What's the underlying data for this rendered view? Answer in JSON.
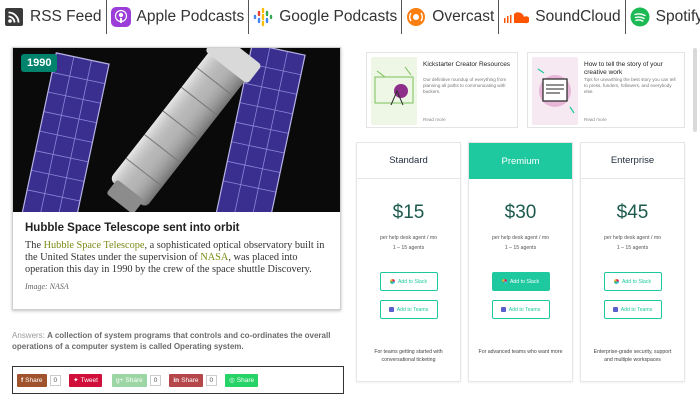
{
  "podcasts": [
    {
      "label": "RSS Feed",
      "icon": "rss-icon"
    },
    {
      "label": "Apple Podcasts",
      "icon": "apple-podcasts-icon"
    },
    {
      "label": "Google Podcasts",
      "icon": "google-podcasts-icon"
    },
    {
      "label": "Overcast",
      "icon": "overcast-icon"
    },
    {
      "label": "SoundCloud",
      "icon": "soundcloud-icon"
    },
    {
      "label": "Spotify",
      "icon": "spotify-icon"
    }
  ],
  "article": {
    "year_badge": "1990",
    "title": "Hubble Space Telescope sent into orbit",
    "text_1": "The ",
    "link_1": "Hubble Space Telescope",
    "text_2": ", a sophisticated optical observatory built in the United States under the supervision of ",
    "link_2": "NASA",
    "text_3": ", was placed into operation this day in 1990 by the crew of the space shuttle Discovery.",
    "credit": "Image: NASA"
  },
  "answers": {
    "label": "Answers: ",
    "text": "A collection of system programs that controls and co-ordinates the overall operations of a computer system is called Operating system."
  },
  "share": [
    {
      "label": "Share",
      "count": "0",
      "color": "#a0522d",
      "icon": "facebook-icon"
    },
    {
      "label": "Tweet",
      "count": "",
      "color": "#d0103a",
      "icon": "twitter-icon"
    },
    {
      "label": "Share",
      "count": "0",
      "color": "#9cd6a4",
      "icon": "google-plus-icon"
    },
    {
      "label": "Share",
      "count": "0",
      "color": "#b5474b",
      "icon": "linkedin-icon"
    },
    {
      "label": "Share",
      "count": "",
      "color": "#25d366",
      "icon": "whatsapp-icon"
    }
  ],
  "resources": [
    {
      "title": "Kickstarter Creator Resources",
      "desc": "Our definitive roundup of everything from planning all paths to communicating with backers.",
      "more": "Read more"
    },
    {
      "title": "How to tell the story of your creative work",
      "desc": "Tips for unearthing the best story you can tell to press, funders, followers, and everybody else.",
      "more": "Read more"
    }
  ],
  "plans": [
    {
      "name": "Standard",
      "price": "$15",
      "per": "per help desk agent / mo",
      "agents": "1 – 15 agents",
      "slack": "Add to Slack",
      "teams": "Add to Teams",
      "foot": "For teams getting started with conversational ticketing"
    },
    {
      "name": "Premium",
      "price": "$30",
      "per": "per help desk agent / mo",
      "agents": "1 – 15 agents",
      "slack": "Add to Slack",
      "teams": "Add to Teams",
      "foot": "For advanced teams who want more"
    },
    {
      "name": "Enterprise",
      "price": "$45",
      "per": "per help desk agent / mo",
      "agents": "1 – 15 agents",
      "slack": "Add to Slack",
      "teams": "Add to Teams",
      "foot": "Enterprise-grade security, support and multiple workspaces"
    }
  ],
  "colors": {
    "accent": "#1ec99f",
    "badge": "#00836c",
    "link": "#7c8b16"
  }
}
